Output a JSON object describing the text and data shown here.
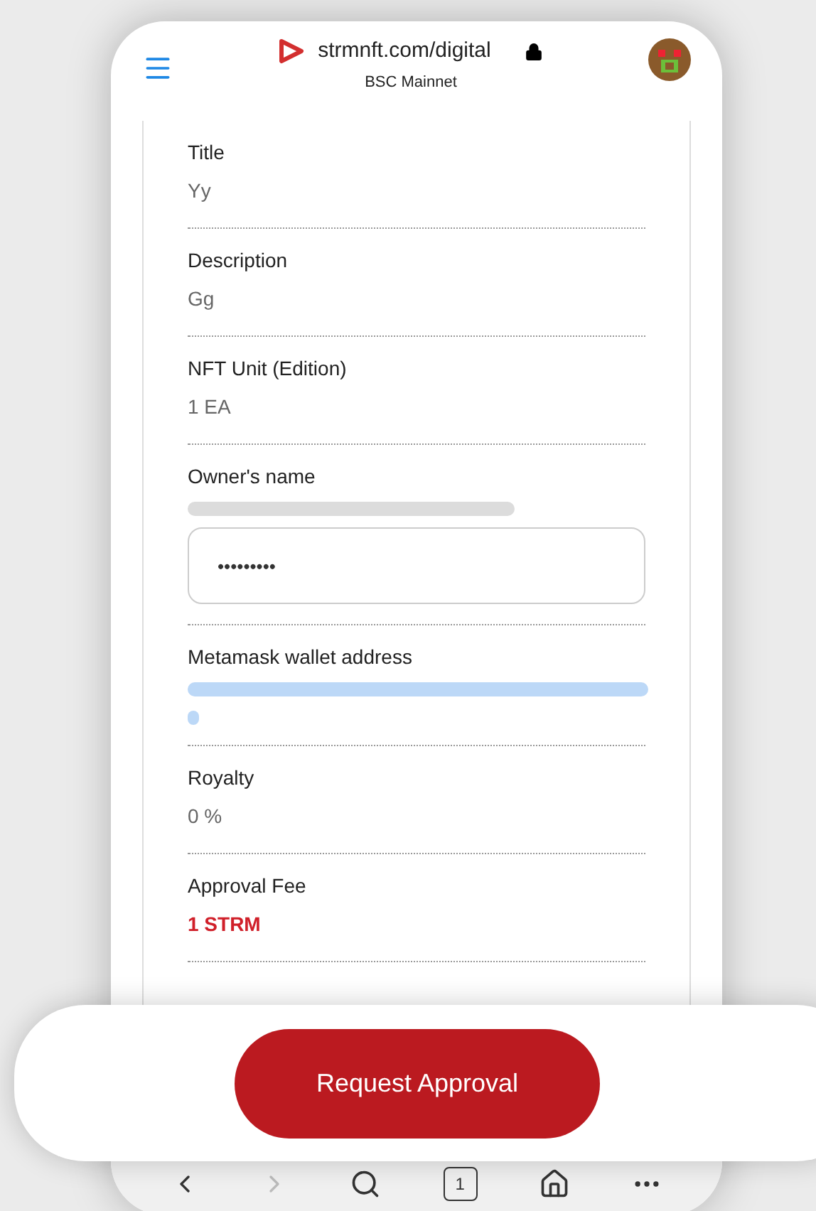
{
  "header": {
    "url": "strmnft.com/digital",
    "network": "BSC Mainnet",
    "secure": true
  },
  "fields": [
    {
      "kind": "plain",
      "label": "Title",
      "value": "Yy",
      "blurred": false
    },
    {
      "kind": "plain",
      "label": "Description",
      "value": "Gg",
      "blurred": false
    },
    {
      "kind": "plain",
      "label": "NFT Unit (Edition)",
      "value": "1 EA",
      "blurred": false
    },
    {
      "kind": "masked",
      "label": "Owner's name",
      "blurred": true,
      "input_value": "•••••••••"
    },
    {
      "kind": "link",
      "label": "Metamask wallet address",
      "blurred": true
    },
    {
      "kind": "plain",
      "label": "Royalty",
      "value": "0 %",
      "blurred": false
    },
    {
      "kind": "accent",
      "label": "Approval Fee",
      "value": "1 STRM",
      "blurred": false
    }
  ],
  "action_button": "Request Approval",
  "browser_nav": {
    "back_enabled": true,
    "forward_enabled": false,
    "tab_count": "1"
  }
}
